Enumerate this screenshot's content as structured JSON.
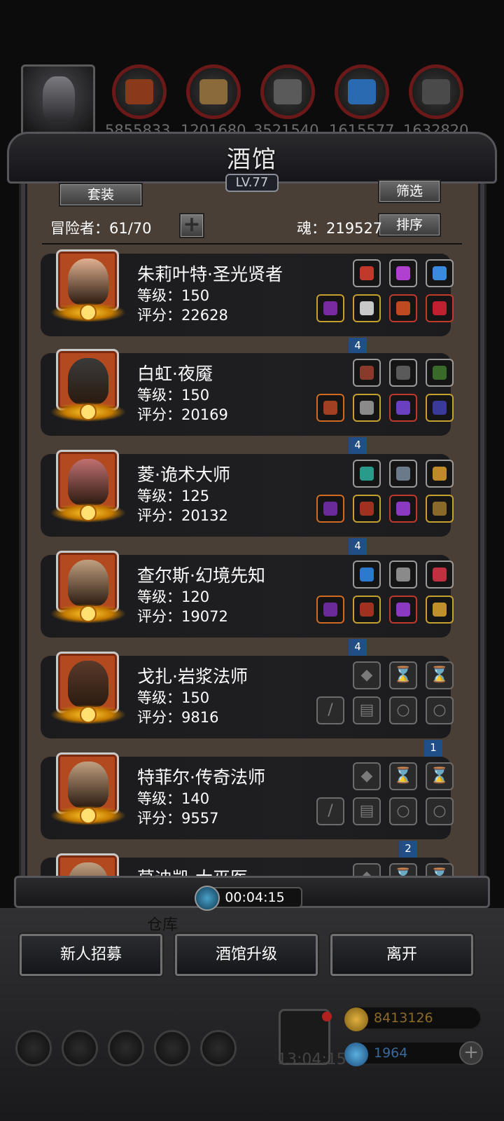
{
  "top_bar": {
    "resources": [
      {
        "icon": "meat-icon",
        "value": "5855833",
        "color": "#8a3a1a"
      },
      {
        "icon": "wood-icon",
        "value": "1201680",
        "color": "#8a6a3a"
      },
      {
        "icon": "iron-icon",
        "value": "3521540",
        "color": "#5a5a5a"
      },
      {
        "icon": "crystal-icon",
        "value": "1615577",
        "color": "#2a6ab0"
      },
      {
        "icon": "stone-icon",
        "value": "1632820",
        "color": "#4a4a4a"
      }
    ]
  },
  "panel": {
    "title": "酒馆",
    "level": "LV.77",
    "set_button": "套装",
    "filter_button": "筛选",
    "sort_button": "排序",
    "adventurers_label": "冒险者：61/70",
    "soul_label": "魂：219527",
    "add_button": "+"
  },
  "heroes": [
    {
      "name": "朱莉叶特·圣光贤者",
      "level": "等级：150",
      "score": "评分：22628",
      "tag": "4",
      "face": "#e0b090",
      "top": [
        "#c0392b",
        "#b040d0",
        "#3a8adf"
      ],
      "bottom": [
        "#7a2aa0",
        "#c8c8c8",
        "#c04a20",
        "#c02030"
      ],
      "top_class": [
        "",
        "",
        ""
      ],
      "bottom_class": [
        "gold",
        "gold",
        "red",
        "red"
      ]
    },
    {
      "name": "白虹·夜魇",
      "level": "等级：150",
      "score": "评分：20169",
      "tag": "4",
      "face": "#3a3a3a",
      "top": [
        "#8a3a2a",
        "#5a5a5a",
        "#3a6a2a"
      ],
      "bottom": [
        "#a04020",
        "#8a8a8a",
        "#6a40c0",
        "#3a3a9a"
      ],
      "top_class": [
        "",
        "",
        ""
      ],
      "bottom_class": [
        "orange",
        "gold",
        "red",
        "gold"
      ]
    },
    {
      "name": "菱·诡术大师",
      "level": "等级：125",
      "score": "评分：20132",
      "tag": "4",
      "face": "#c07070",
      "top": [
        "#2a9a8a",
        "#6a7a8a",
        "#c08a2a"
      ],
      "bottom": [
        "#6a2a9a",
        "#a03020",
        "#8a3ac0",
        "#8a6a2a"
      ],
      "top_class": [
        "",
        "",
        ""
      ],
      "bottom_class": [
        "orange",
        "gold",
        "red",
        "gold"
      ]
    },
    {
      "name": "查尔斯·幻境先知",
      "level": "等级：120",
      "score": "评分：19072",
      "tag": "4",
      "face": "#c0a080",
      "top": [
        "#2a7ad0",
        "#8a8a8a",
        "#c03040"
      ],
      "bottom": [
        "#6a2a9a",
        "#a03020",
        "#8a3ac0",
        "#c0902a"
      ],
      "top_class": [
        "",
        "",
        ""
      ],
      "bottom_class": [
        "orange",
        "gold",
        "red",
        "gold"
      ]
    },
    {
      "name": "戈扎·岩浆法师",
      "level": "等级：150",
      "score": "评分：9816",
      "tag": "1",
      "face": "#5a3a2a",
      "top": [],
      "bottom": [],
      "empty": true
    },
    {
      "name": "特菲尔·传奇法师",
      "level": "等级：140",
      "score": "评分：9557",
      "tag": "2",
      "face": "#c0a080",
      "top": [],
      "bottom": [],
      "empty": true
    },
    {
      "name": "莫迪凯·大巫医",
      "level": "",
      "score": "",
      "tag": "",
      "face": "#c0a080",
      "top": [],
      "bottom": [],
      "empty": true
    }
  ],
  "timer": "00:04:15",
  "bottom_buttons": {
    "recruit": "新人招募",
    "upgrade": "酒馆升级",
    "leave": "离开"
  },
  "background": {
    "warehouse_text": "仓库",
    "gift_timer": "13:04:15",
    "gold": "8413126",
    "diamond": "1964"
  }
}
